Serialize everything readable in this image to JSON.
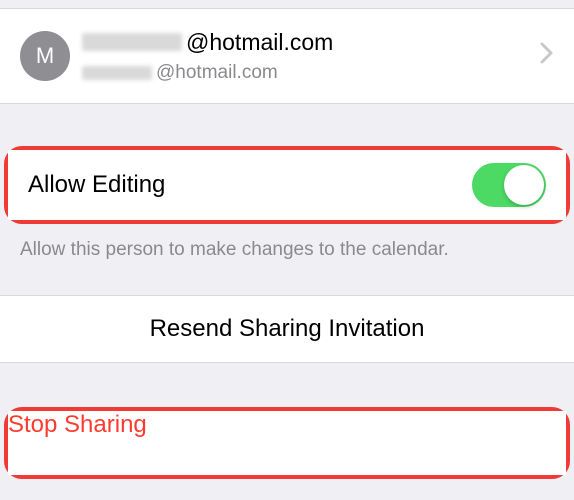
{
  "contact": {
    "avatar_initial": "M",
    "primary_domain": "@hotmail.com",
    "secondary_domain": "@hotmail.com"
  },
  "allow_editing": {
    "label": "Allow Editing",
    "enabled": true,
    "description": "Allow this person to make changes to the calendar."
  },
  "actions": {
    "resend": "Resend Sharing Invitation",
    "stop": "Stop Sharing"
  },
  "colors": {
    "destructive": "#ff3b30",
    "toggle_on": "#4cd964",
    "highlight": "#ef3a36"
  }
}
